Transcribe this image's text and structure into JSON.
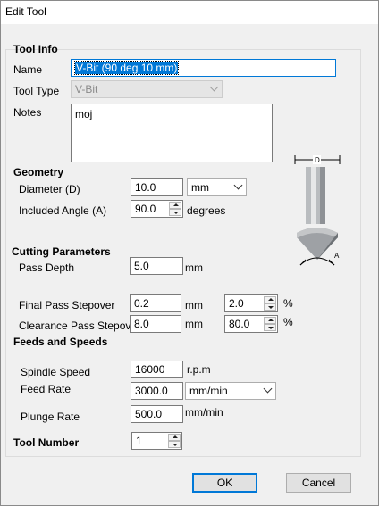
{
  "window": {
    "title": "Edit Tool"
  },
  "tool_info": {
    "section": "Tool Info",
    "name_label": "Name",
    "name_value": "V-Bit (90 deg 10 mm)",
    "type_label": "Tool Type",
    "type_value": "V-Bit",
    "notes_label": "Notes",
    "notes_value": "moj"
  },
  "geometry": {
    "section": "Geometry",
    "diameter_label": "Diameter (D)",
    "diameter_value": "10.0",
    "units_value": "mm",
    "angle_label": "Included Angle (A)",
    "angle_value": "90.0",
    "angle_unit": "degrees"
  },
  "diagram": {
    "d_label": "D",
    "a_label": "A"
  },
  "cutting": {
    "section": "Cutting Parameters",
    "pass_depth_label": "Pass Depth",
    "pass_depth_value": "5.0",
    "pass_depth_unit": "mm",
    "final_label": "Final Pass Stepover",
    "final_value": "0.2",
    "final_unit": "mm",
    "final_pct": "2.0",
    "final_pct_unit": "%",
    "clear_label": "Clearance Pass Stepover",
    "clear_value": "8.0",
    "clear_unit": "mm",
    "clear_pct": "80.0",
    "clear_pct_unit": "%"
  },
  "feeds": {
    "section": "Feeds and Speeds",
    "spindle_label": "Spindle Speed",
    "spindle_value": "16000",
    "spindle_unit": "r.p.m",
    "feed_label": "Feed Rate",
    "feed_value": "3000.0",
    "feed_unit": "mm/min",
    "plunge_label": "Plunge Rate",
    "plunge_value": "500.0",
    "plunge_unit": "mm/min"
  },
  "tool_number": {
    "label": "Tool Number",
    "value": "1"
  },
  "buttons": {
    "ok": "OK",
    "cancel": "Cancel"
  }
}
